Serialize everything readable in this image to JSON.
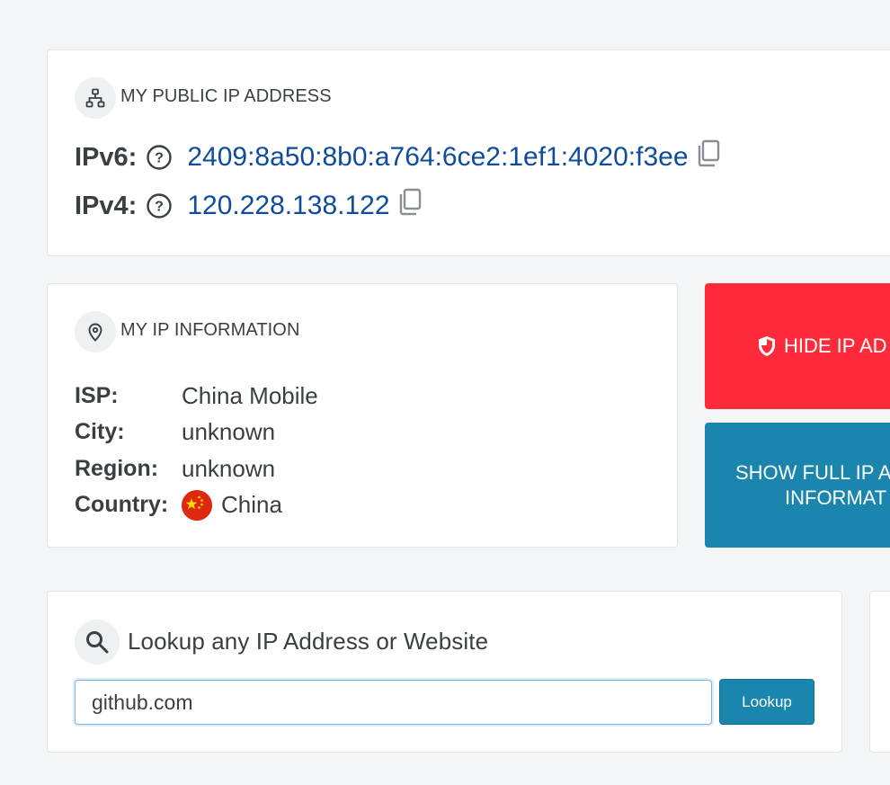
{
  "public_ip": {
    "title": "MY PUBLIC IP ADDRESS",
    "ipv6_label": "IPv6:",
    "ipv6_value": "2409:8a50:8b0:a764:6ce2:1ef1:4020:f3ee",
    "ipv4_label": "IPv4:",
    "ipv4_value": "120.228.138.122"
  },
  "ip_info": {
    "title": "MY IP INFORMATION",
    "rows": [
      {
        "key": "ISP:",
        "value": "China Mobile"
      },
      {
        "key": "City:",
        "value": "unknown"
      },
      {
        "key": "Region:",
        "value": "unknown"
      },
      {
        "key": "Country:",
        "value": "China"
      }
    ]
  },
  "actions": {
    "hide_ip_label": "HIDE IP AD",
    "show_full_line1": "SHOW FULL IP A",
    "show_full_line2": "INFORMAT"
  },
  "lookup": {
    "title": "Lookup any IP Address or Website",
    "input_value": "github.com",
    "button_label": "Lookup"
  },
  "colors": {
    "ip_link": "#0f4c9b",
    "danger": "#ff2b3b",
    "primary": "#1a86ad",
    "background": "#f4f5f7"
  },
  "icons": {
    "public_ip": "network-icon",
    "ip_info": "location-pin-icon",
    "help": "question-circle-icon",
    "copy": "copy-icon",
    "shield": "shield-icon",
    "search": "search-icon",
    "flag": "china-flag-icon"
  }
}
